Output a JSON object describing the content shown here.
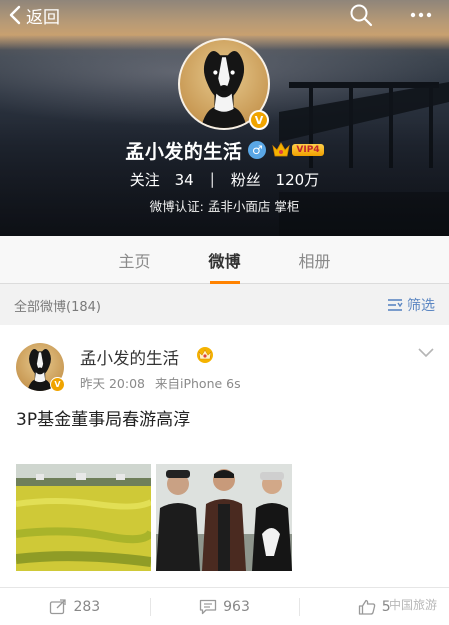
{
  "nav": {
    "back_label": "返回"
  },
  "profile": {
    "name": "孟小发的生活",
    "verified_badge": "V",
    "vip_label": "VIP4",
    "following_label": "关注",
    "following_count": "34",
    "separator": "|",
    "followers_label": "粉丝",
    "followers_count": "120万",
    "verification": "微博认证: 孟非小面店 掌柜",
    "gender_symbol": "♂"
  },
  "tabs": [
    {
      "label": "主页",
      "active": false
    },
    {
      "label": "微博",
      "active": true
    },
    {
      "label": "相册",
      "active": false
    }
  ],
  "filter": {
    "count_label": "全部微博(184)",
    "filter_label": "筛选"
  },
  "post": {
    "author": "孟小发的生活",
    "time": "昨天 20:08",
    "source": "来自iPhone 6s",
    "text": "3P基金董事局春游高淳",
    "verified_badge": "V"
  },
  "actions": {
    "repost_count": "283",
    "comment_count": "963",
    "like_count": "5"
  },
  "watermark": {
    "text": "中国旅游"
  },
  "colors": {
    "accent": "#ff8200",
    "link": "#5b86c2",
    "badge": "#f0a400"
  },
  "icons": [
    "back-chevron-icon",
    "search-icon",
    "more-icon",
    "crown-icon",
    "filter-icon",
    "chevron-down-icon",
    "repost-icon",
    "comment-icon",
    "like-icon"
  ]
}
